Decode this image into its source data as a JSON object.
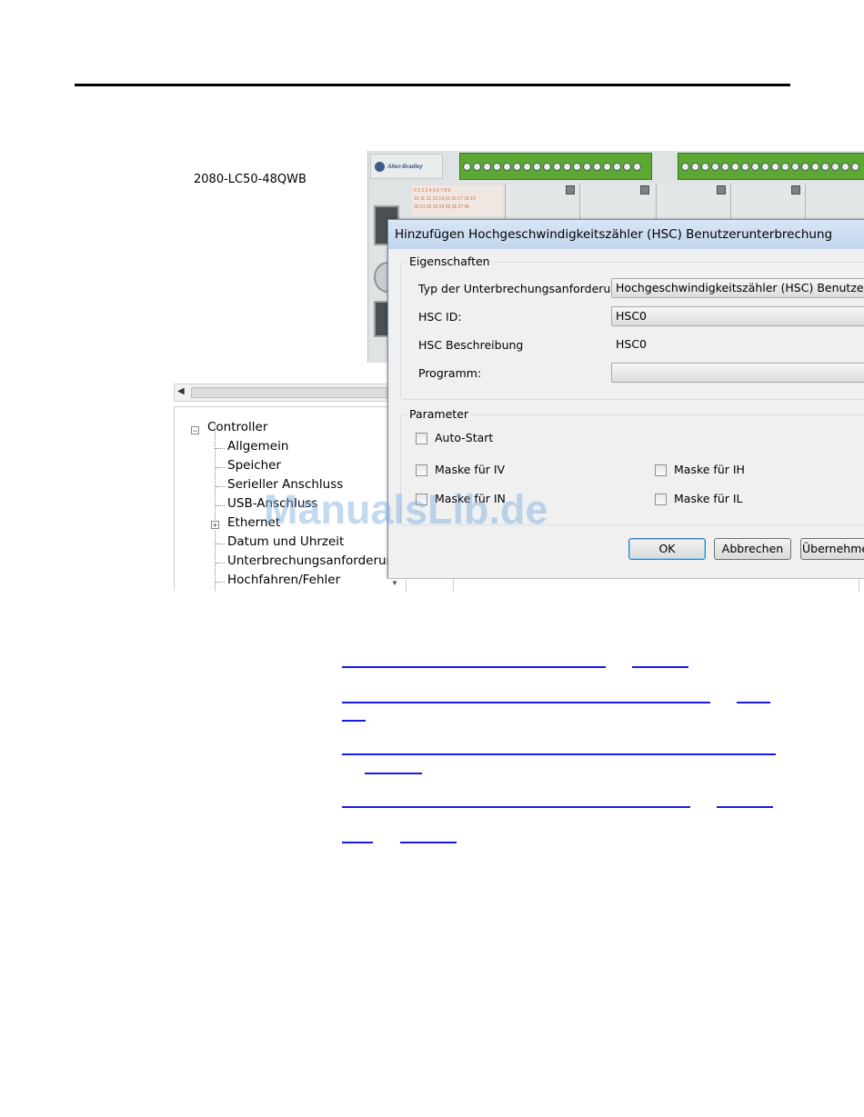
{
  "page": {
    "model_label": "2080-LC50-48QWB"
  },
  "hardware": {
    "brand": "Allen-Bradley",
    "led_rows": [
      "0  1  2  3  4  5  6  7  8  9",
      "10 11 12 13 14 15 16 17 18 19",
      "20 21 22 23 24 25 26 27"
    ],
    "led_suffix": "IN"
  },
  "tree": {
    "root": "Controller",
    "items": [
      "Allgemein",
      "Speicher",
      "Serieller Anschluss",
      "USB-Anschluss",
      "Ethernet",
      "Datum und Uhrzeit",
      "Unterbrechungsanforderung",
      "Hochfahren/Fehler"
    ]
  },
  "dialog": {
    "title": "Hinzufügen Hochgeschwindigkeitszähler (HSC) Benutzerunterbrechung",
    "properties": {
      "group_label": "Eigenschaften",
      "type_label": "Typ der Unterbrechungsanforderung",
      "type_value": "Hochgeschwindigkeitszähler (HSC) Benutzerunterbrechung",
      "hsc_id_label": "HSC ID:",
      "hsc_id_value": "HSC0",
      "hsc_desc_label": "HSC Beschreibung",
      "hsc_desc_value": "HSC0",
      "program_label": "Programm:",
      "program_value": ""
    },
    "parameters": {
      "group_label": "Parameter",
      "auto_start": "Auto-Start",
      "mask_iv": "Maske für IV",
      "mask_ih": "Maske für IH",
      "mask_in": "Maske für IN",
      "mask_il": "Maske für IL"
    },
    "buttons": {
      "ok": "OK",
      "cancel": "Abbrechen",
      "apply": "Übernehmen"
    }
  },
  "watermark": "ManualsLib.de",
  "colors": {
    "link": "#1a1ae8",
    "terminal": "#5da832",
    "dialog_title": "#c3d6ed"
  }
}
